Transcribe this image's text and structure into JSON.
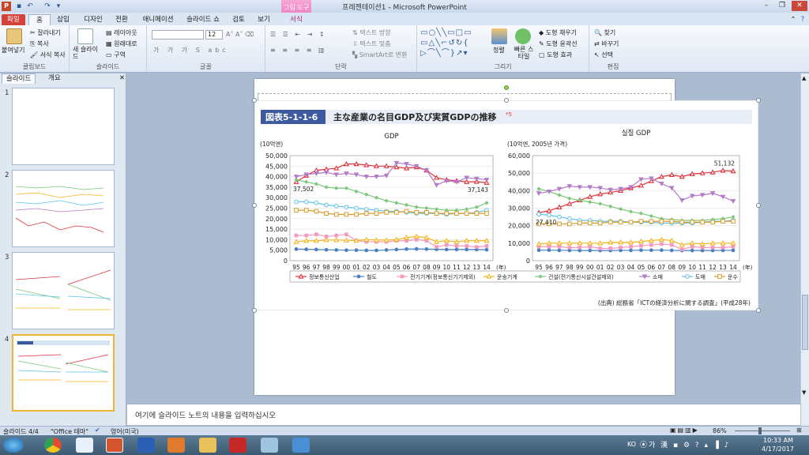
{
  "window": {
    "title": "프레젠테이션1 - Microsoft PowerPoint",
    "context_tab_group": "그림 도구"
  },
  "tabs": [
    "파일",
    "홈",
    "삽입",
    "디자인",
    "전환",
    "애니메이션",
    "슬라이드 쇼",
    "검토",
    "보기",
    "서식"
  ],
  "ribbon": {
    "clipboard": {
      "paste": "붙여넣기",
      "cut": "잘라내기",
      "copy": "복사",
      "format_painter": "서식 복사",
      "label": "클립보드"
    },
    "slides": {
      "new_slide": "새 슬라이드",
      "layout": "레이아웃",
      "reset": "원래대로",
      "section": "구역",
      "label": "슬라이드"
    },
    "font": {
      "size": "12",
      "label": "글꼴"
    },
    "paragraph": {
      "text_direction": "텍스트 방향",
      "align_text": "텍스트 맞춤",
      "smartart": "SmartArt로 변환",
      "label": "단락"
    },
    "drawing": {
      "arrange": "정렬",
      "quick_styles": "빠른 스타일",
      "shape_fill": "도형 채우기",
      "shape_outline": "도형 윤곽선",
      "shape_effects": "도형 효과",
      "label": "그리기"
    },
    "editing": {
      "find": "찾기",
      "replace": "바꾸기",
      "select": "선택",
      "label": "편집"
    }
  },
  "pane": {
    "tabs": [
      "슬라이드",
      "개요"
    ],
    "slides": [
      "1",
      "2",
      "3",
      "4"
    ]
  },
  "notes": {
    "placeholder": "여기에 슬라이드 노트의 내용을 입력하십시오"
  },
  "status": {
    "slide": "슬라이드 4/4",
    "theme": "\"Office 테마\"",
    "lang": "영어(미국)",
    "zoom": "86%"
  },
  "taskbar": {
    "lang": "KO",
    "time": "10:33 AM",
    "date": "4/17/2017"
  },
  "figure": {
    "badge": "図表5-1-1-6",
    "title": "主な産業の名目GDP及び実質GDPの推移",
    "note_mark": "*5",
    "source": "(出典) 総務省「ICTの経済分析に関する調査」(平成28年)"
  },
  "chart_data": [
    {
      "type": "line",
      "title": "GDP",
      "ylabel": "(10억엔)",
      "ylim": [
        0,
        50000
      ],
      "yticks": [
        "0",
        "5,000",
        "10,000",
        "15,000",
        "20,000",
        "25,000",
        "30,000",
        "35,000",
        "40,000",
        "45,000",
        "50,000"
      ],
      "categories": [
        "95",
        "96",
        "97",
        "98",
        "99",
        "00",
        "01",
        "02",
        "03",
        "04",
        "05",
        "06",
        "07",
        "08",
        "09",
        "10",
        "11",
        "12",
        "13",
        "14"
      ],
      "xunit": "(年)",
      "annotations": {
        "first": "37,502",
        "last": "37,143"
      },
      "series": [
        {
          "name": "정보통신산업",
          "color": "#e0303a",
          "marker": "triangle",
          "values": [
            37502,
            40500,
            43000,
            43500,
            44000,
            46000,
            46000,
            45500,
            45000,
            45000,
            44500,
            44000,
            44500,
            43000,
            39500,
            38500,
            38000,
            37500,
            37600,
            37143
          ]
        },
        {
          "name": "철도",
          "color": "#4a7fc1",
          "marker": "circle",
          "values": [
            5500,
            5400,
            5300,
            5200,
            5100,
            5000,
            5000,
            4900,
            4900,
            5100,
            5300,
            5500,
            5600,
            5500,
            5400,
            5300,
            5300,
            5300,
            5300,
            5200
          ]
        },
        {
          "name": "전기기계(정보통신기기제외)",
          "color": "#f49ac1",
          "marker": "square",
          "values": [
            12000,
            12000,
            12500,
            11500,
            12000,
            12500,
            9500,
            9000,
            9000,
            9000,
            9500,
            9500,
            10000,
            9500,
            6500,
            7500,
            7000,
            7000,
            6500,
            7000
          ]
        },
        {
          "name": "운송기계",
          "color": "#f5b51e",
          "marker": "triangle",
          "values": [
            9000,
            9500,
            9500,
            9800,
            9800,
            9700,
            9600,
            10000,
            9800,
            9800,
            10000,
            11000,
            11500,
            11000,
            9000,
            9500,
            9000,
            9500,
            9500,
            9500
          ]
        },
        {
          "name": "건설(전기통신시설건설제외)",
          "color": "#7bc87a",
          "marker": "diamond",
          "values": [
            38500,
            37500,
            36500,
            35000,
            34500,
            34500,
            33000,
            31500,
            30000,
            28500,
            27500,
            26500,
            25500,
            25000,
            24500,
            24000,
            24000,
            24500,
            25500,
            27500
          ]
        },
        {
          "name": "소매",
          "color": "#b27cc9",
          "marker": "invtriangle",
          "values": [
            40000,
            41000,
            41500,
            42000,
            41000,
            41500,
            41000,
            40000,
            40000,
            40500,
            46500,
            46000,
            45000,
            43000,
            36000,
            38000,
            37500,
            39500,
            39000,
            38500
          ]
        },
        {
          "name": "도매",
          "color": "#5bc4e8",
          "marker": "circle-open",
          "values": [
            28000,
            28000,
            27500,
            26500,
            26000,
            25500,
            25000,
            24500,
            24000,
            23500,
            23500,
            23000,
            22500,
            22500,
            22500,
            22000,
            22500,
            22500,
            23000,
            24000
          ]
        },
        {
          "name": "운수",
          "color": "#d89c2a",
          "marker": "square-open",
          "values": [
            24000,
            24000,
            23500,
            22500,
            22000,
            22000,
            22000,
            22500,
            22500,
            23000,
            23000,
            23500,
            23000,
            23000,
            22500,
            22500,
            22500,
            22500,
            22500,
            22500
          ]
        }
      ]
    },
    {
      "type": "line",
      "title": "실질 GDP",
      "ylabel": "(10억엔, 2005년 가격)",
      "ylim": [
        0,
        60000
      ],
      "yticks": [
        "0",
        "10,000",
        "20,000",
        "30,000",
        "40,000",
        "50,000",
        "60,000"
      ],
      "categories": [
        "95",
        "96",
        "97",
        "98",
        "99",
        "00",
        "01",
        "02",
        "03",
        "04",
        "05",
        "06",
        "07",
        "08",
        "09",
        "10",
        "11",
        "12",
        "13",
        "14"
      ],
      "xunit": "(年)",
      "annotations": {
        "first": "27,410",
        "last": "51,132"
      },
      "series": [
        {
          "name": "정보통신산업",
          "color": "#e0303a",
          "marker": "triangle",
          "values": [
            27410,
            28500,
            30500,
            32500,
            34500,
            36500,
            38000,
            39000,
            40000,
            41500,
            43000,
            45500,
            48000,
            49000,
            48000,
            49500,
            50000,
            50500,
            51500,
            51132
          ]
        },
        {
          "name": "철도",
          "color": "#4a7fc1",
          "marker": "circle",
          "values": [
            6000,
            6000,
            5900,
            5900,
            5800,
            5800,
            5800,
            5800,
            5900,
            5900,
            6000,
            6000,
            6000,
            5900,
            5800,
            5800,
            5800,
            5800,
            5900,
            5900
          ]
        },
        {
          "name": "전기기계(정보통신기기제외)",
          "color": "#f49ac1",
          "marker": "square",
          "values": [
            8000,
            8000,
            8000,
            7500,
            7500,
            8000,
            7000,
            7000,
            7500,
            8000,
            8500,
            9000,
            9500,
            9000,
            6500,
            8000,
            7500,
            7500,
            7500,
            8000
          ]
        },
        {
          "name": "운송기계",
          "color": "#f5b51e",
          "marker": "triangle",
          "values": [
            9500,
            10000,
            10000,
            10000,
            10000,
            10000,
            10000,
            10500,
            10500,
            10500,
            11000,
            11500,
            12000,
            11500,
            9000,
            10000,
            9500,
            10000,
            10000,
            10000
          ]
        },
        {
          "name": "건설(전기통신시설건설제외)",
          "color": "#7bc87a",
          "marker": "diamond",
          "values": [
            41000,
            39500,
            37500,
            35500,
            34500,
            33500,
            32500,
            31000,
            29500,
            28000,
            27000,
            25500,
            24000,
            23500,
            23000,
            23000,
            23000,
            23500,
            24000,
            25000
          ]
        },
        {
          "name": "소매",
          "color": "#b27cc9",
          "marker": "invtriangle",
          "values": [
            38500,
            39500,
            41000,
            42500,
            42000,
            42000,
            41500,
            40500,
            41000,
            42000,
            46500,
            47000,
            44000,
            41500,
            34500,
            37000,
            37500,
            38500,
            36500,
            34000
          ]
        },
        {
          "name": "도매",
          "color": "#5bc4e8",
          "marker": "circle-open",
          "values": [
            26500,
            26000,
            25000,
            24000,
            23000,
            23000,
            22500,
            22500,
            22500,
            22000,
            22000,
            22000,
            21500,
            21500,
            21500,
            21500,
            22000,
            22500,
            22500,
            23000
          ]
        },
        {
          "name": "운수",
          "color": "#d89c2a",
          "marker": "square-open",
          "values": [
            21000,
            21000,
            21000,
            21000,
            21500,
            21500,
            21500,
            22000,
            22000,
            22000,
            22500,
            22500,
            22500,
            22500,
            22000,
            22000,
            22000,
            22000,
            22500,
            22500
          ]
        }
      ]
    }
  ]
}
